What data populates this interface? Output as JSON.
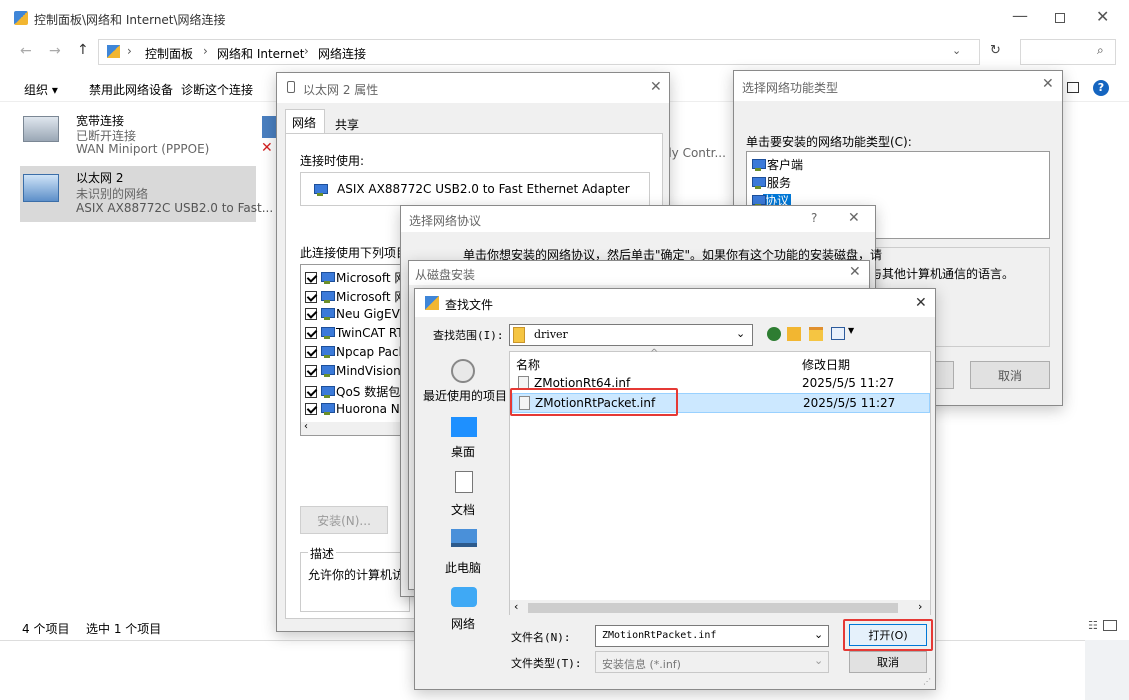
{
  "explorer": {
    "title": "控制面板\\网络和 Internet\\网络连接",
    "breadcrumb": [
      "控制面板",
      "网络和 Internet",
      "网络连接"
    ],
    "toolbar": [
      "组织 ▾",
      "禁用此网络设备",
      "诊断这个连接"
    ],
    "connections": [
      {
        "name": "宽带连接",
        "status": "已断开连接",
        "device": "WAN Miniport (PPPOE)"
      },
      {
        "name": "以太网 2",
        "status": "未识别的网络",
        "device": "ASIX AX88772C USB2.0 to Fast..."
      }
    ],
    "partial_right_text": "ily Contr...",
    "status_count": "4 个项目",
    "status_selected": "选中 1 个项目"
  },
  "props": {
    "title": "以太网 2 属性",
    "tabs": [
      "网络",
      "共享"
    ],
    "connect_using_label": "连接时使用:",
    "adapter": "ASIX AX88772C USB2.0 to Fast Ethernet Adapter",
    "items_label": "此连接使用下列项目",
    "items": [
      "Microsoft 网",
      "Microsoft 网",
      "Neu GigEVi",
      "TwinCAT RT",
      "Npcap Pack",
      "MindVision",
      "QoS 数据包",
      "Huorona N"
    ],
    "install_btn": "安装(N)...",
    "desc_label": "描述",
    "desc_text": "允许你的计算机访"
  },
  "featureType": {
    "title": "选择网络功能类型",
    "prompt": "单击要安装的网络功能类型(C):",
    "items": [
      "客户端",
      "服务",
      "协议"
    ],
    "desc_partial": "与其他计算机通信的语言。",
    "cancel": "取消"
  },
  "protocol": {
    "title": "选择网络协议",
    "help": "?",
    "text": "单击你想安装的网络协议，然后单击\"确定\"。如果你有这个功能的安装磁盘，请"
  },
  "fromDisk": {
    "title": "从磁盘安装"
  },
  "findFile": {
    "title": "查找文件",
    "look_in_label": "查找范围(I):",
    "look_in_value": "driver",
    "places": [
      "最近使用的项目",
      "桌面",
      "文档",
      "此电脑",
      "网络"
    ],
    "col_name": "名称",
    "col_date": "修改日期",
    "files": [
      {
        "name": "ZMotionRt64.inf",
        "date": "2025/5/5 11:27"
      },
      {
        "name": "ZMotionRtPacket.inf",
        "date": "2025/5/5 11:27"
      }
    ],
    "filename_label": "文件名(N):",
    "filename_value": "ZMotionRtPacket.inf",
    "filetype_label": "文件类型(T):",
    "filetype_value": "安装信息 (*.inf)",
    "open_btn": "打开(O)",
    "cancel_btn": "取消"
  }
}
